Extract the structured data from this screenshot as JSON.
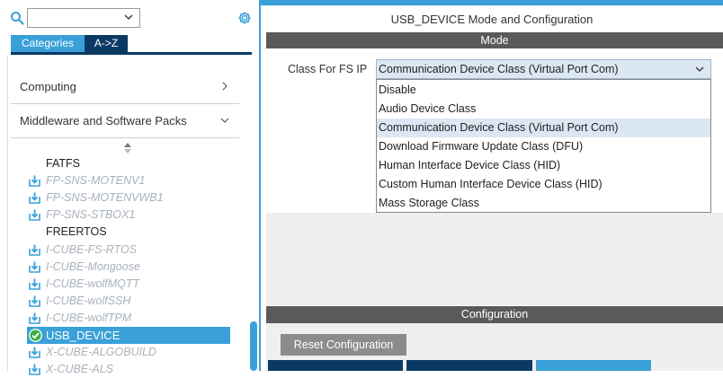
{
  "search": {
    "value": "",
    "placeholder": ""
  },
  "tabs": [
    {
      "label": "Categories"
    },
    {
      "label": "A->Z"
    }
  ],
  "categories": {
    "computing": "Computing",
    "middleware": "Middleware and Software Packs"
  },
  "middleware_items": [
    {
      "label": "FATFS",
      "state": "plain"
    },
    {
      "label": "FP-SNS-MOTENV1",
      "state": "disabled",
      "icon": "download-icon"
    },
    {
      "label": "FP-SNS-MOTENVWB1",
      "state": "disabled",
      "icon": "download-icon"
    },
    {
      "label": "FP-SNS-STBOX1",
      "state": "disabled",
      "icon": "download-icon"
    },
    {
      "label": "FREERTOS",
      "state": "plain"
    },
    {
      "label": "I-CUBE-FS-RTOS",
      "state": "disabled",
      "icon": "download-icon"
    },
    {
      "label": "I-CUBE-Mongoose",
      "state": "disabled",
      "icon": "download-icon"
    },
    {
      "label": "I-CUBE-wolfMQTT",
      "state": "disabled",
      "icon": "download-icon"
    },
    {
      "label": "I-CUBE-wolfSSH",
      "state": "disabled",
      "icon": "download-icon"
    },
    {
      "label": "I-CUBE-wolfTPM",
      "state": "disabled",
      "icon": "download-icon"
    },
    {
      "label": "USB_DEVICE",
      "state": "selected",
      "icon": "check-circle-icon"
    },
    {
      "label": "X-CUBE-ALGOBUILD",
      "state": "disabled",
      "icon": "download-icon"
    },
    {
      "label": "X-CUBE-ALS",
      "state": "disabled",
      "icon": "download-icon"
    }
  ],
  "right": {
    "title": "USB_DEVICE Mode and Configuration",
    "mode_header": "Mode",
    "class_label": "Class For FS IP",
    "class_value": "Communication Device Class (Virtual Port Com)",
    "options": [
      "Disable",
      "Audio Device Class",
      "Communication Device Class (Virtual Port Com)",
      "Download Firmware Update Class (DFU)",
      "Human Interface Device Class (HID)",
      "Custom Human Interface Device Class (HID)",
      "Mass Storage Class"
    ],
    "selected_option_index": 2,
    "config_header": "Configuration",
    "reset_button": "Reset Configuration"
  },
  "colors": {
    "accent": "#3aa0d8",
    "dark_tab": "#0a3a64",
    "header_gray": "#5a5a5a",
    "selected_option_bg": "#dbe7f2"
  }
}
